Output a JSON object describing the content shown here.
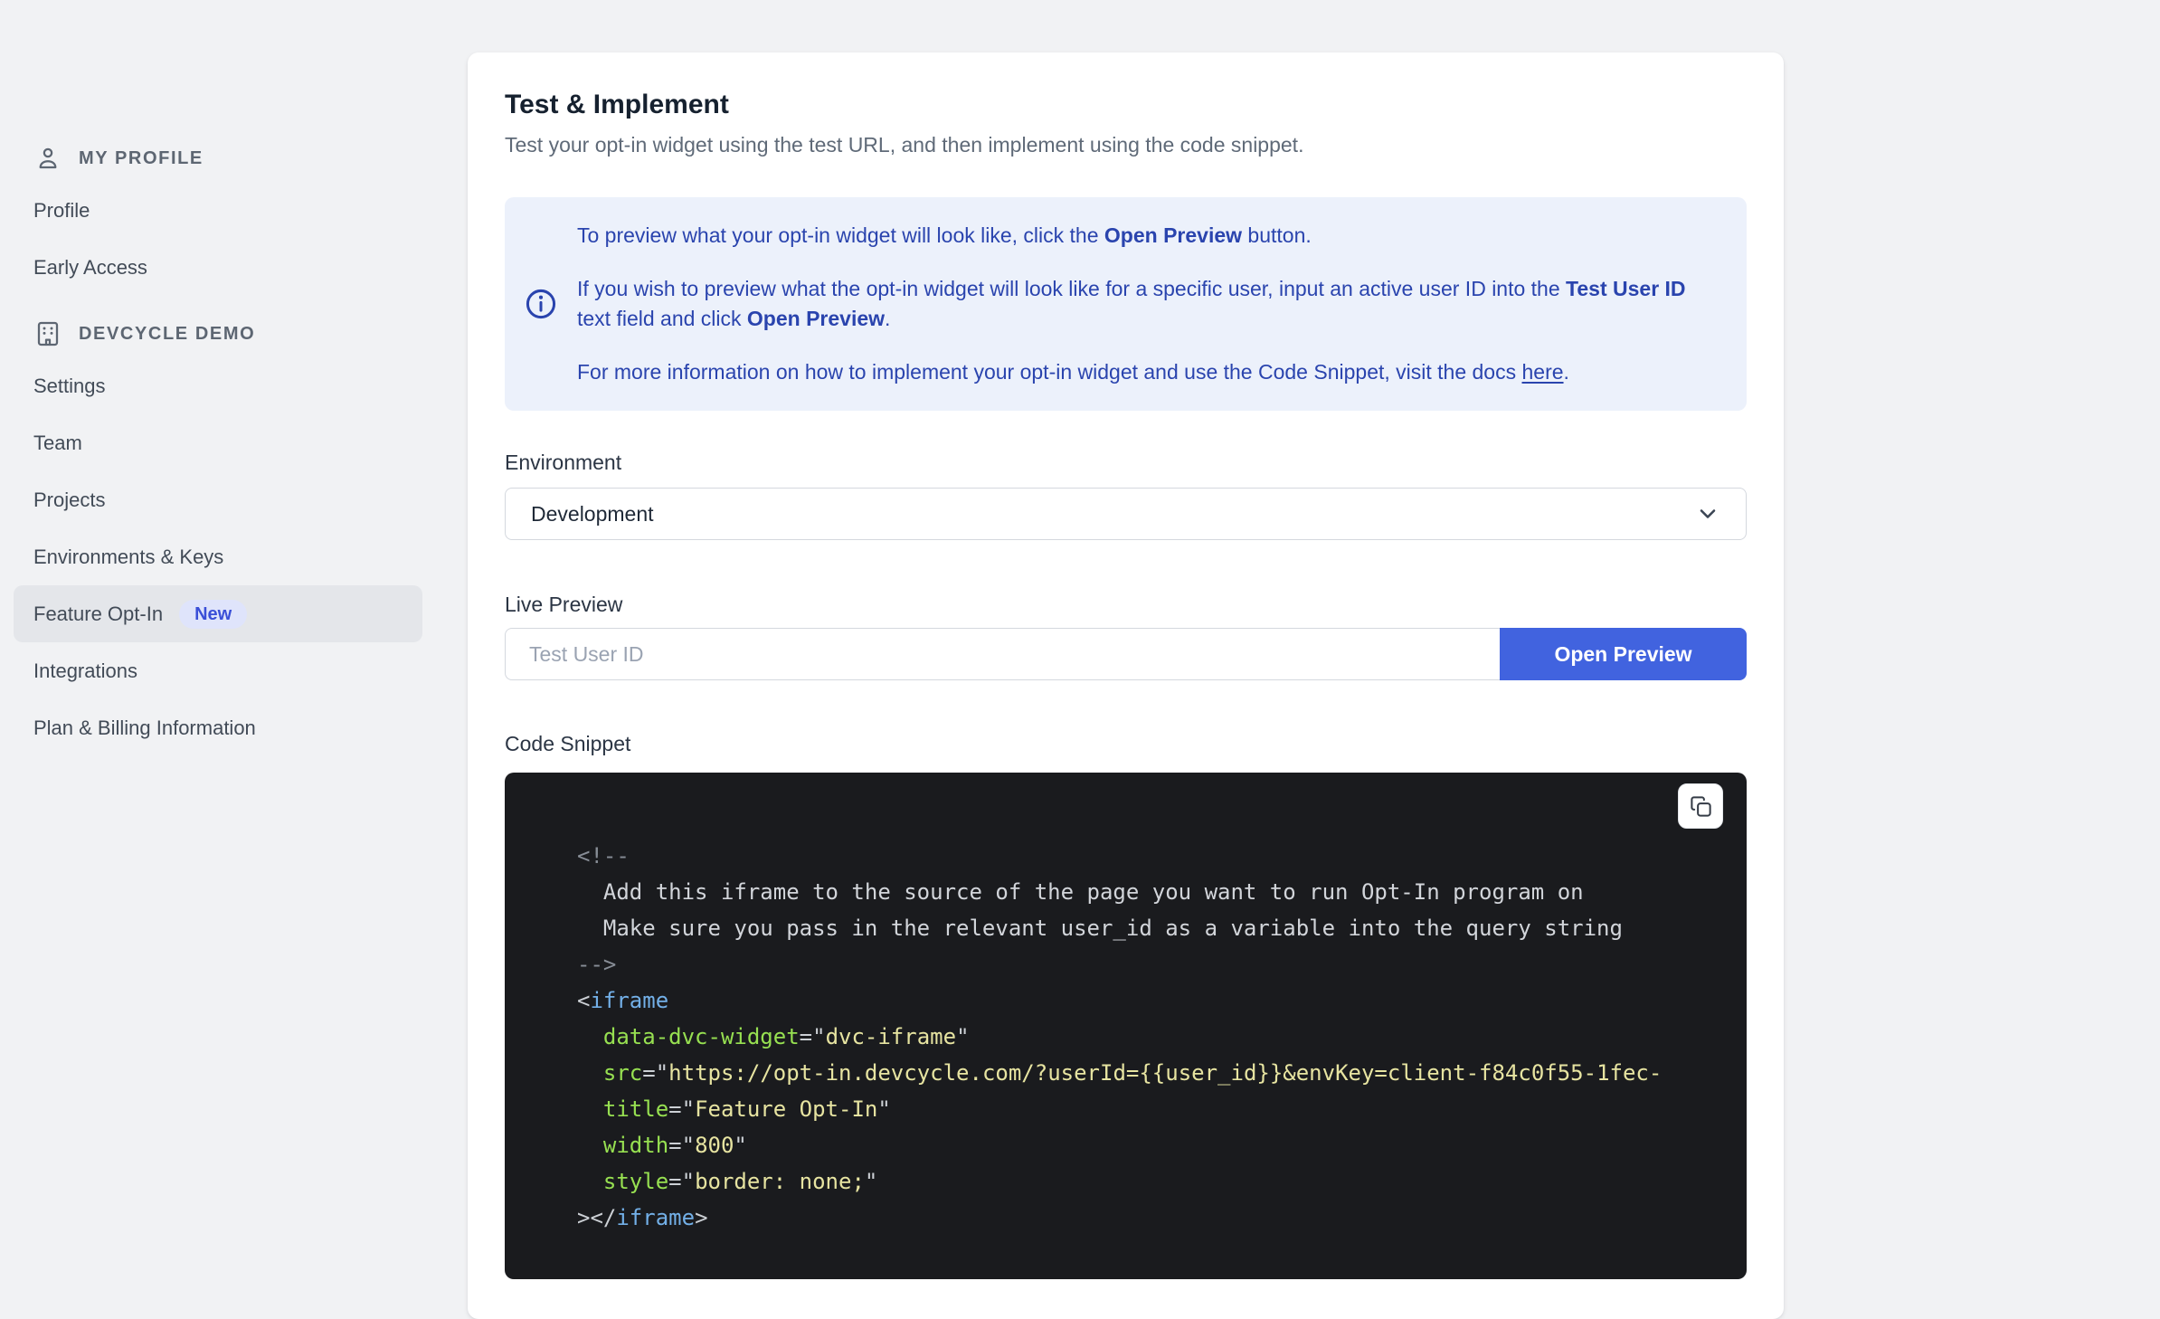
{
  "colors": {
    "page_bg": "#f1f2f4",
    "active_bg": "#e4e6ea",
    "badge_bg": "#dfe4fb",
    "badge_text": "#3a4fd8",
    "info_bg": "#ecf1fb",
    "info_text": "#2a44ae",
    "accent_blue": "#4163df",
    "code_bg": "#1a1b1e",
    "code_comment_delim": "#878d96",
    "code_comment_text": "#d2d5da",
    "code_punct": "#ccd0d5",
    "code_tag": "#73b0e8",
    "code_attr": "#97e051",
    "code_string": "#e7e4a1"
  },
  "sidebar": {
    "sections": [
      {
        "label": "MY PROFILE",
        "icon": "user-icon",
        "items": [
          {
            "label": "Profile"
          },
          {
            "label": "Early Access"
          }
        ]
      },
      {
        "label": "DEVCYCLE DEMO",
        "icon": "building-icon",
        "items": [
          {
            "label": "Settings"
          },
          {
            "label": "Team"
          },
          {
            "label": "Projects"
          },
          {
            "label": "Environments & Keys"
          },
          {
            "label": "Feature Opt-In",
            "badge": "New",
            "active": true
          },
          {
            "label": "Integrations"
          },
          {
            "label": "Plan & Billing Information"
          }
        ]
      }
    ]
  },
  "main": {
    "title": "Test & Implement",
    "subtitle": "Test your opt-in widget using the test URL, and then implement using the code snippet.",
    "info_box": {
      "icon": "info-icon",
      "paragraphs": [
        [
          {
            "t": "To preview what your opt-in widget will look like, click the "
          },
          {
            "t": "Open Preview",
            "b": true
          },
          {
            "t": " button."
          }
        ],
        [
          {
            "t": "If you wish to preview what the opt-in widget will look like for a specific user, input an active user ID into the "
          },
          {
            "t": "Test User ID",
            "b": true
          },
          {
            "t": " text field and click "
          },
          {
            "t": "Open Preview",
            "b": true
          },
          {
            "t": "."
          }
        ],
        [
          {
            "t": "For more information on how to implement your opt-in widget and use the Code Snippet, visit the docs "
          },
          {
            "t": "here",
            "u": true
          },
          {
            "t": "."
          }
        ]
      ]
    },
    "environment": {
      "label": "Environment",
      "selected": "Development",
      "icon": "chevron-down-icon"
    },
    "live_preview": {
      "label": "Live Preview",
      "placeholder": "Test User ID",
      "button": "Open Preview"
    },
    "code_snippet": {
      "label": "Code Snippet",
      "copy_icon": "copy-icon",
      "lines": [
        [
          {
            "t": "<!--",
            "c": "cm"
          }
        ],
        [
          {
            "t": "  Add this iframe to the source of the page you want to run Opt-In program on",
            "c": "cmt"
          }
        ],
        [
          {
            "t": "  Make sure you pass in the relevant user_id as a variable into the query string",
            "c": "cmt"
          }
        ],
        [
          {
            "t": "-->",
            "c": "cm"
          }
        ],
        [
          {
            "t": "<",
            "c": "p"
          },
          {
            "t": "iframe",
            "c": "tag"
          }
        ],
        [
          {
            "t": "  ",
            "c": "p"
          },
          {
            "t": "data-dvc-widget",
            "c": "attr"
          },
          {
            "t": "=\"",
            "c": "p"
          },
          {
            "t": "dvc-iframe",
            "c": "str"
          },
          {
            "t": "\"",
            "c": "p"
          }
        ],
        [
          {
            "t": "  ",
            "c": "p"
          },
          {
            "t": "src",
            "c": "attr"
          },
          {
            "t": "=\"",
            "c": "p"
          },
          {
            "t": "https://opt-in.devcycle.com/?userId={{user_id}}&envKey=client-f84c0f55-1fec-",
            "c": "str"
          }
        ],
        [
          {
            "t": "  ",
            "c": "p"
          },
          {
            "t": "title",
            "c": "attr"
          },
          {
            "t": "=\"",
            "c": "p"
          },
          {
            "t": "Feature Opt-In",
            "c": "str"
          },
          {
            "t": "\"",
            "c": "p"
          }
        ],
        [
          {
            "t": "  ",
            "c": "p"
          },
          {
            "t": "width",
            "c": "attr"
          },
          {
            "t": "=\"",
            "c": "p"
          },
          {
            "t": "800",
            "c": "str"
          },
          {
            "t": "\"",
            "c": "p"
          }
        ],
        [
          {
            "t": "  ",
            "c": "p"
          },
          {
            "t": "style",
            "c": "attr"
          },
          {
            "t": "=\"",
            "c": "p"
          },
          {
            "t": "border: none;",
            "c": "str"
          },
          {
            "t": "\"",
            "c": "p"
          }
        ],
        [
          {
            "t": "></",
            "c": "p"
          },
          {
            "t": "iframe",
            "c": "tag"
          },
          {
            "t": ">",
            "c": "p"
          }
        ]
      ]
    }
  }
}
